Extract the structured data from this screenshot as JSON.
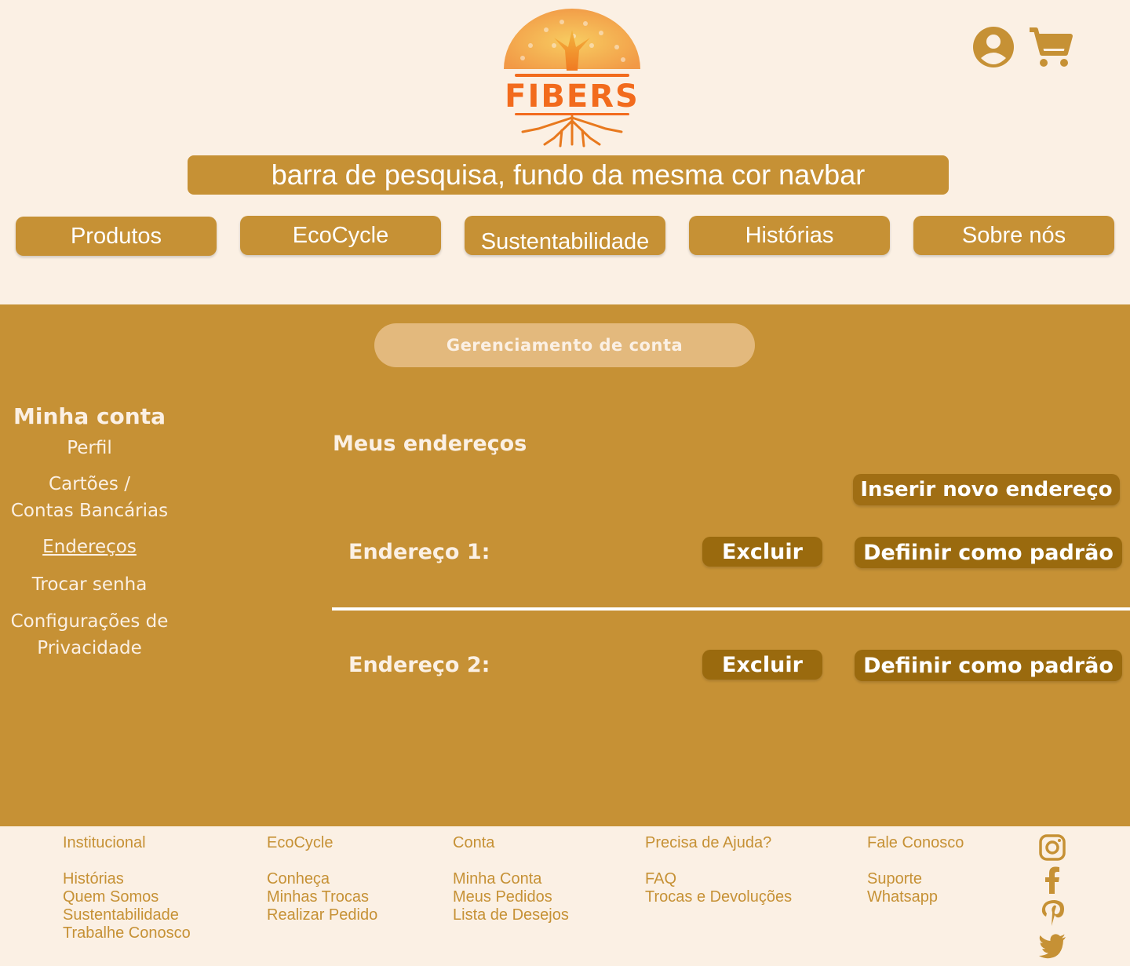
{
  "brand": {
    "name": "FIBERS",
    "accent": "#C69135",
    "logo_orange": "#F26B1D",
    "background": "#FBF0E4"
  },
  "header": {
    "icons": [
      "user-account-icon",
      "cart-icon"
    ],
    "search_text": "barra de pesquisa, fundo da mesma cor navbar"
  },
  "nav": {
    "items": [
      {
        "label": "Produtos"
      },
      {
        "label": "EcoCycle"
      },
      {
        "label": "Sustentabilidade"
      },
      {
        "label": "Histórias"
      },
      {
        "label": "Sobre nós"
      }
    ]
  },
  "main": {
    "account_title": "Gerenciamento de conta",
    "sidebar": {
      "title": "Minha conta",
      "items": [
        {
          "label": "Perfil"
        },
        {
          "label": "Cartões /\nContas Bancárias"
        },
        {
          "label": "Endereços",
          "active": true
        },
        {
          "label": "Trocar senha"
        },
        {
          "label": "Configurações de\nPrivacidade"
        }
      ]
    },
    "section_title": "Meus endereços",
    "add_button": "Inserir novo endereço",
    "addresses": [
      {
        "label": "Endereço 1:",
        "delete": "Excluir",
        "set_default": "Defiinir como padrão"
      },
      {
        "label": "Endereço 2:",
        "delete": "Excluir",
        "set_default": "Defiinir como padrão"
      }
    ]
  },
  "footer": {
    "columns": [
      {
        "heading": "Institucional",
        "links": [
          "Histórias",
          "Quem Somos",
          "Sustentabilidade",
          "Trabalhe Conosco"
        ]
      },
      {
        "heading": "EcoCycle",
        "links": [
          "Conheça",
          "Minhas Trocas",
          "Realizar Pedido"
        ]
      },
      {
        "heading": "Conta",
        "links": [
          "Minha Conta",
          "Meus Pedidos",
          "Lista de Desejos"
        ]
      },
      {
        "heading": "Precisa de Ajuda?",
        "links": [
          "FAQ",
          "Trocas e Devoluções"
        ]
      },
      {
        "heading": "Fale Conosco",
        "links": [
          "Suporte",
          "Whatsapp"
        ]
      }
    ],
    "social": [
      "instagram-icon",
      "facebook-icon",
      "pinterest-icon",
      "twitter-icon"
    ]
  }
}
